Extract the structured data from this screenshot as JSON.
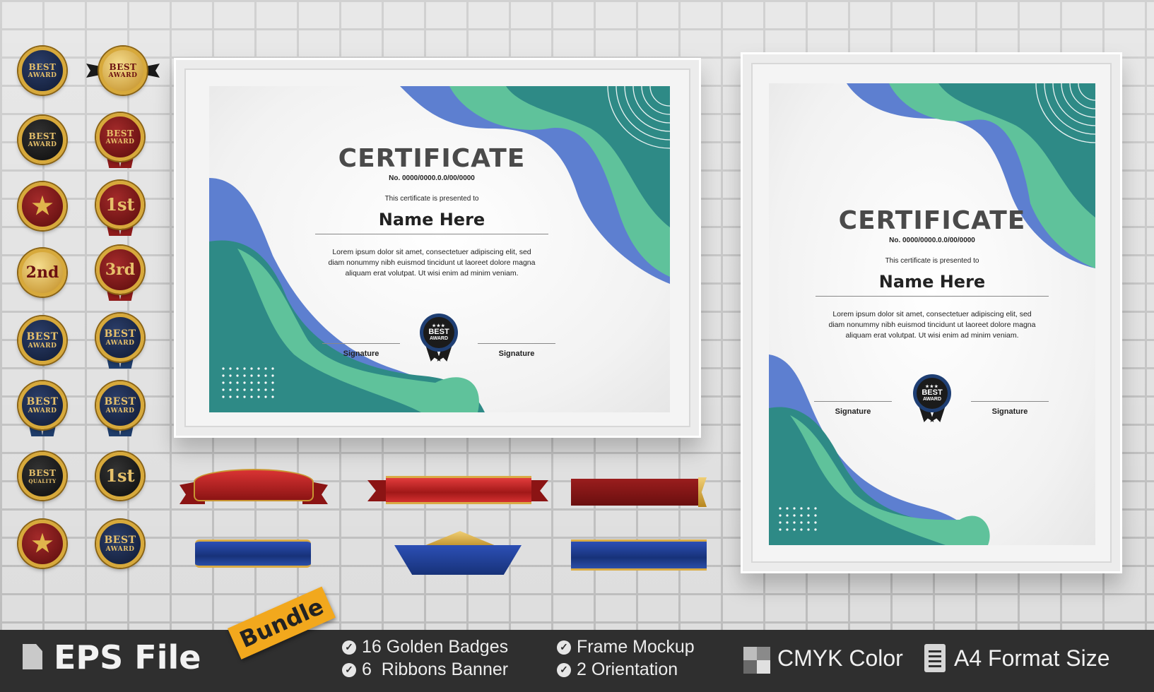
{
  "certificates": [
    {
      "title": "CERTIFICATE",
      "number": "No. 0000/0000.0.0/00/0000",
      "presented": "This certificate is presented to",
      "name": "Name Here",
      "body": [
        "Lorem ipsum dolor sit amet, consectetuer adipiscing elit, sed",
        "diam nonummy nibh euismod tincidunt ut laoreet dolore magna",
        "aliquam erat volutpat. Ut wisi enim ad minim veniam."
      ],
      "signature_left": "Signature",
      "signature_right": "Signature",
      "seal_line1": "BEST",
      "seal_line2": "AWARD",
      "seal_stars": "★★★"
    },
    {
      "title": "CERTIFICATE",
      "number": "No. 0000/0000.0.0/00/0000",
      "presented": "This certificate is presented to",
      "name": "Name Here",
      "body": [
        "Lorem ipsum dolor sit amet, consectetuer adipiscing elit, sed",
        "diam nonummy nibh euismod tincidunt ut laoreet dolore magna",
        "aliquam erat volutpat. Ut wisi enim ad minim veniam."
      ],
      "signature_left": "Signature",
      "signature_right": "Signature",
      "seal_line1": "BEST",
      "seal_line2": "AWARD",
      "seal_stars": "★★★"
    }
  ],
  "badges": [
    {
      "line1": "BEST",
      "line2": "AWARD",
      "style": "navy"
    },
    {
      "line1": "BEST",
      "line2": "AWARD",
      "style": "gold"
    },
    {
      "line1": "BEST",
      "line2": "AWARD",
      "style": "dark"
    },
    {
      "line1": "BEST",
      "line2": "AWARD",
      "style": "red"
    },
    {
      "line1": "★",
      "line2": "",
      "style": "red"
    },
    {
      "line1": "1st",
      "line2": "",
      "style": "red"
    },
    {
      "line1": "2nd",
      "line2": "",
      "style": "gold"
    },
    {
      "line1": "3rd",
      "line2": "",
      "style": "red"
    },
    {
      "line1": "BEST",
      "line2": "AWARD",
      "style": "navy"
    },
    {
      "line1": "BEST",
      "line2": "AWARD",
      "style": "navy"
    },
    {
      "line1": "BEST",
      "line2": "AWARD",
      "style": "navy"
    },
    {
      "line1": "BEST",
      "line2": "AWARD",
      "style": "navy"
    },
    {
      "line1": "BEST",
      "line2": "QUALITY",
      "style": "dark"
    },
    {
      "line1": "1st",
      "line2": "",
      "style": "dark"
    },
    {
      "line1": "★",
      "line2": "",
      "style": "red"
    },
    {
      "line1": "BEST",
      "line2": "AWARD",
      "style": "navy"
    }
  ],
  "footer": {
    "file_type": "EPS File",
    "bundle": "Bundle",
    "features": [
      "16 Golden Badges",
      "6  Ribbons Banner",
      "Frame Mockup",
      "2 Orientation"
    ],
    "color_mode": "CMYK Color",
    "format_size": "A4 Format Size"
  },
  "colors": {
    "teal": "#2e8a86",
    "mint": "#5fc29b",
    "periwinkle": "#5d7fd0",
    "footer_bg": "#2f2f2f",
    "bundle_tag": "#f2a81d",
    "gold": "#d7a93b"
  },
  "icons": {
    "file": "file-icon",
    "check": "check-circle-icon",
    "cmyk": "cmyk-squares-icon",
    "document": "document-icon"
  }
}
